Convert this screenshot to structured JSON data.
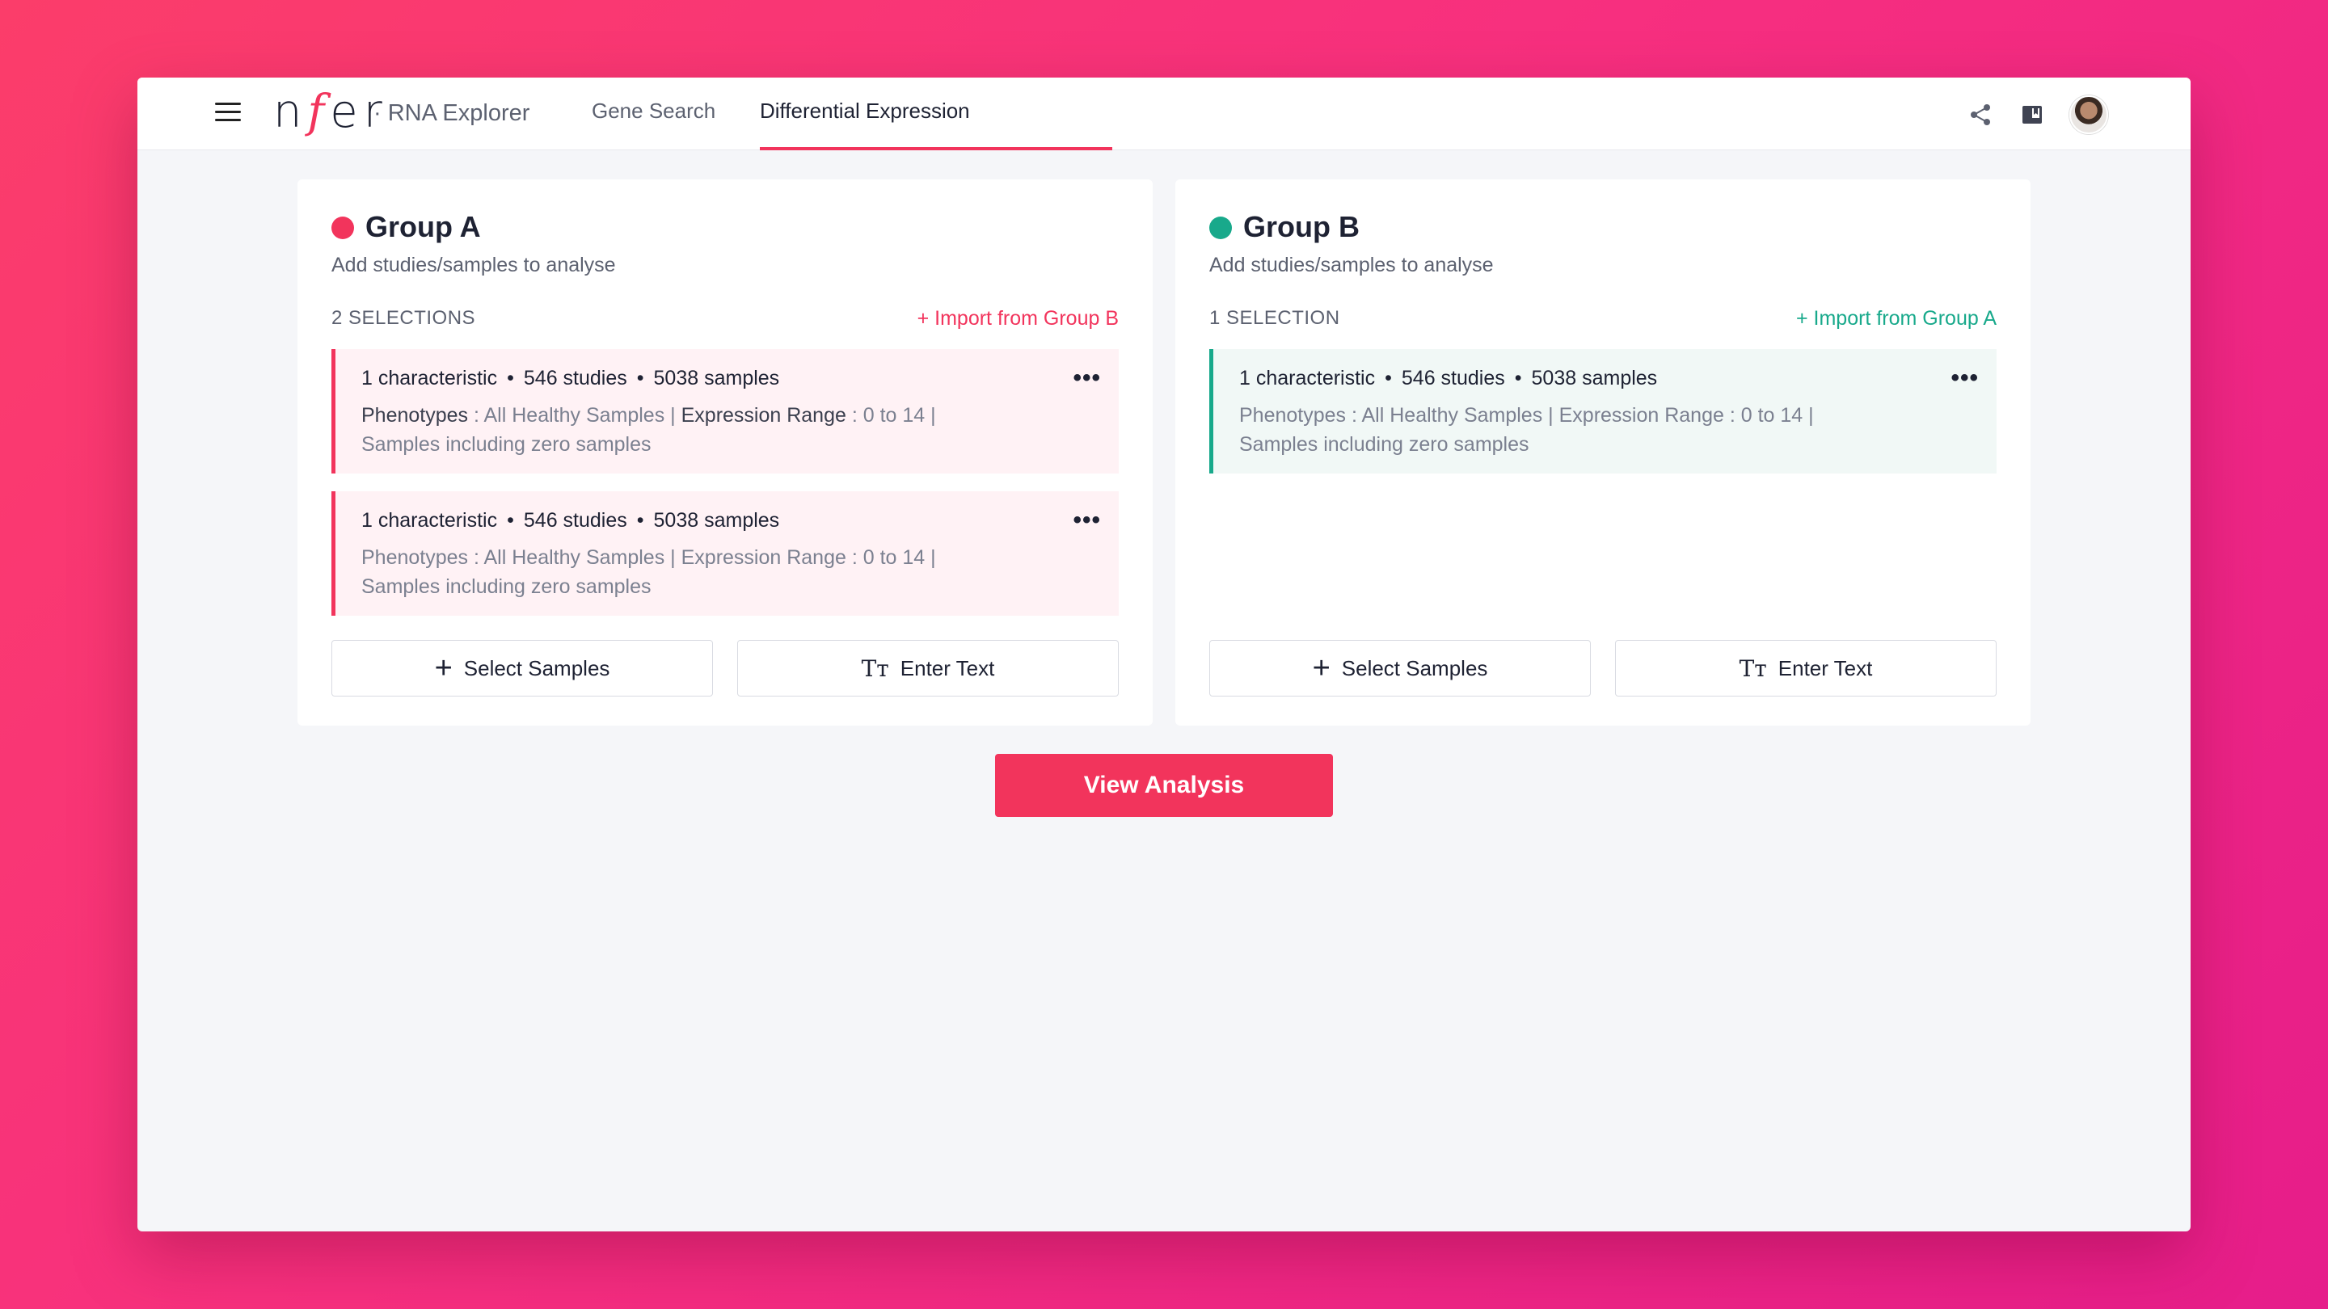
{
  "app": {
    "logo": "nfer",
    "subtitle": "· RNA Explorer"
  },
  "nav": {
    "tabs": [
      {
        "label": "Gene Search",
        "active": false
      },
      {
        "label": "Differential Expression",
        "active": true
      }
    ],
    "accent_color": "#f2345c"
  },
  "header_icons": [
    "share-icon",
    "book-icon",
    "avatar"
  ],
  "groups": [
    {
      "title": "Group A",
      "color": "#f2345c",
      "subtitle": "Add studies/samples to analyse",
      "selection_count": "2 SELECTIONS",
      "import_label": "+ Import from Group B",
      "selections": [
        {
          "characteristic": "1 characteristic",
          "studies": "546 studies",
          "samples": "5038 samples",
          "phenotypes_label": "Phenotypes",
          "phenotypes_value": " : All Healthy Samples | ",
          "range_label": "Expression Range",
          "range_value": " : 0 to 14 |",
          "zero_note": "Samples including zero samples"
        },
        {
          "characteristic": "1 characteristic",
          "studies": "546 studies",
          "samples": "5038 samples",
          "phenotypes_label": "Phenotypes",
          "phenotypes_value": " : All Healthy Samples | ",
          "range_label": "Expression Range",
          "range_value": " : 0 to 14 |",
          "zero_note": "Samples including zero samples"
        }
      ],
      "buttons": {
        "select": "Select Samples",
        "text": "Enter Text"
      }
    },
    {
      "title": "Group B",
      "color": "#18a98b",
      "subtitle": "Add studies/samples to analyse",
      "selection_count": "1 SELECTION",
      "import_label": "+ Import from Group A",
      "selections": [
        {
          "characteristic": "1 characteristic",
          "studies": "546 studies",
          "samples": "5038 samples",
          "phenotypes_label": "Phenotypes",
          "phenotypes_value": " : All Healthy Samples | ",
          "range_label": "Expression Range",
          "range_value": " : 0 to 14 |",
          "zero_note": "Samples including zero samples"
        }
      ],
      "buttons": {
        "select": "Select Samples",
        "text": "Enter Text"
      }
    }
  ],
  "actions": {
    "view_analysis": "View Analysis"
  }
}
